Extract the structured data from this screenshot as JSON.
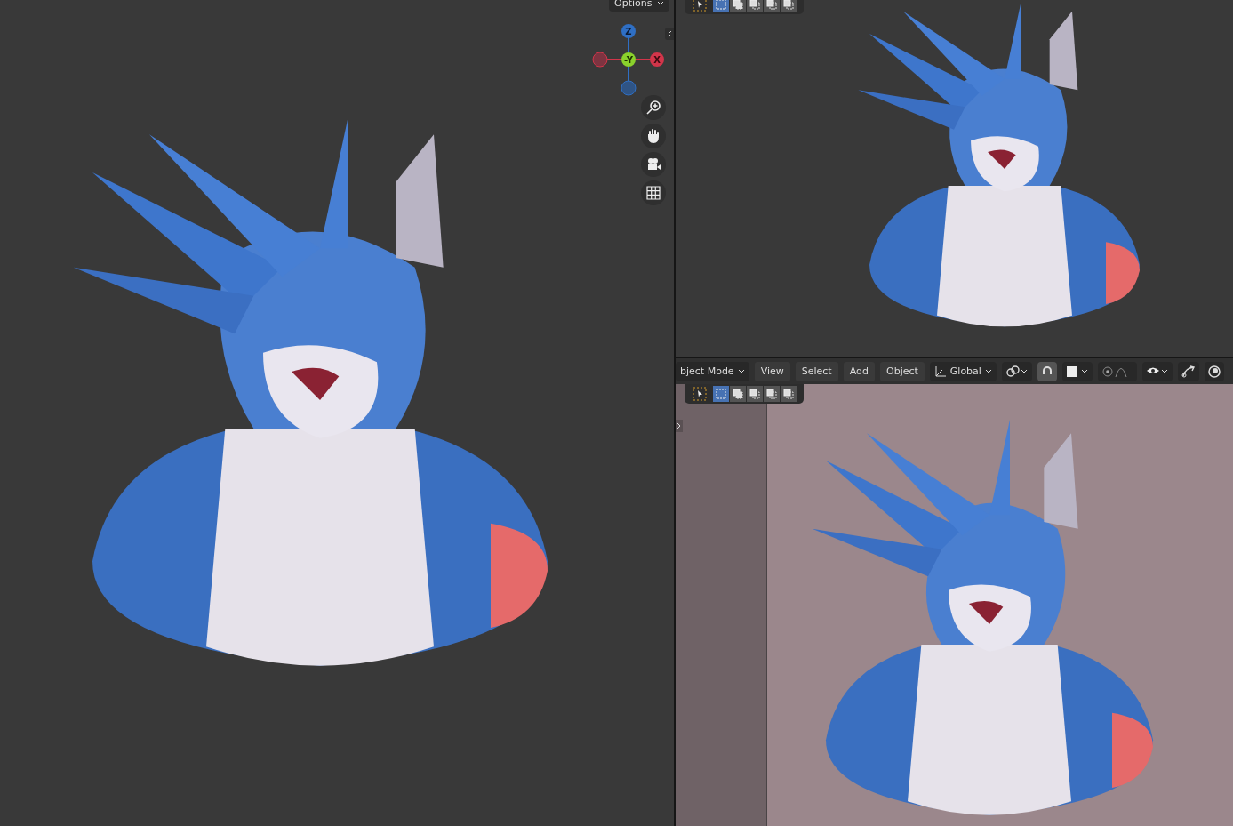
{
  "left_viewport": {
    "options": "Options",
    "gizmo": {
      "axes": [
        {
          "label": "Z",
          "color": "#2f6fc4"
        },
        {
          "label": "-Y",
          "color": "#8ad12c"
        },
        {
          "label": "X",
          "color": "#d2354a"
        }
      ]
    }
  },
  "top_right_viewport": {
    "select_modes": [
      {
        "selected": true
      },
      {
        "selected": false
      },
      {
        "selected": false
      },
      {
        "selected": false
      },
      {
        "selected": false
      }
    ]
  },
  "bottom_right_viewport": {
    "header": {
      "mode": "bject Mode",
      "menus": [
        "View",
        "Select",
        "Add",
        "Object"
      ],
      "orientation": "Global"
    },
    "select_modes": [
      {
        "selected": true
      },
      {
        "selected": false
      },
      {
        "selected": false
      },
      {
        "selected": false
      },
      {
        "selected": false
      }
    ]
  }
}
